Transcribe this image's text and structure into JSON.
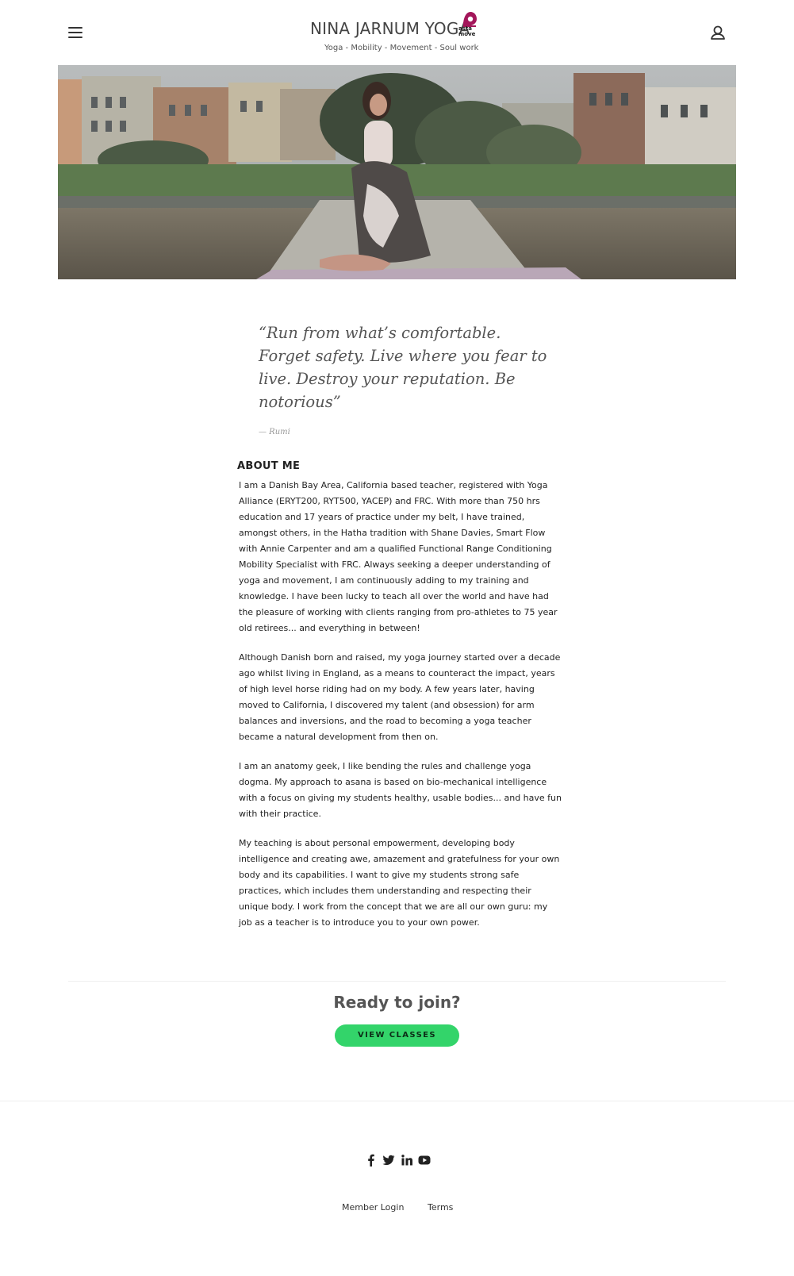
{
  "header": {
    "brand_name": "NINA JARNUM YOGA",
    "tagline": "Yoga - Mobility - Movement - Soul work",
    "partner_logo_text": "asta move",
    "colors": {
      "partner_accent": "#a3165a",
      "text": "#444444"
    }
  },
  "hero": {
    "alt": "Yoga teacher in a seated twist on a mat outdoors by a lake with houses behind"
  },
  "quote": {
    "text": "“Run from what’s comfortable. Forget safety. Live where you fear to live. Destroy your reputation. Be notorious”",
    "author": "— Rumi"
  },
  "about": {
    "heading": "ABOUT ME",
    "paragraphs": [
      "I am a Danish Bay Area, California based teacher, registered with Yoga Alliance (ERYT200, RYT500, YACEP) and FRC. With more than 750 hrs education and 17 years of practice under my belt, I have trained, amongst others, in the Hatha tradition with Shane Davies, Smart Flow with Annie Carpenter and am a qualified Functional Range Conditioning Mobility Specialist with FRC. Always seeking a deeper understanding of yoga and movement, I am continuously adding to my training and knowledge. I have been lucky to teach all over the world and have had the pleasure of working with clients ranging from pro-athletes to 75 year old retirees... and everything in between!",
      "Although Danish born and raised, my yoga journey started over a decade ago whilst living in England, as a means to counteract the impact,  years of high level horse riding had on my body. A few years later, having moved to California,  I discovered my  talent (and obsession) for arm balances and inversions, and the road to becoming a yoga teacher became a natural development from then on.",
      "I am an anatomy geek, I like bending the rules and challenge yoga dogma. My approach to asana is based  on bio-mechanical intelligence with a focus on giving my students healthy, usable bodies... and have fun with their practice.",
      "My teaching is about personal empowerment, developing body intelligence and creating awe, amazement and gratefulness for your own body and its capabilities.  I want to give my students strong safe practices, which includes  them understanding and respecting their unique body. I work from the concept that we are all our own guru: my job as a teacher is to introduce you to your own power."
    ]
  },
  "cta": {
    "title": "Ready to join?",
    "button_label": "VIEW CLASSES",
    "button_color": "#33d46a"
  },
  "footer": {
    "social_icons": [
      "facebook-icon",
      "twitter-icon",
      "linkedin-icon",
      "youtube-icon"
    ],
    "links": [
      "Member Login",
      "Terms"
    ]
  }
}
